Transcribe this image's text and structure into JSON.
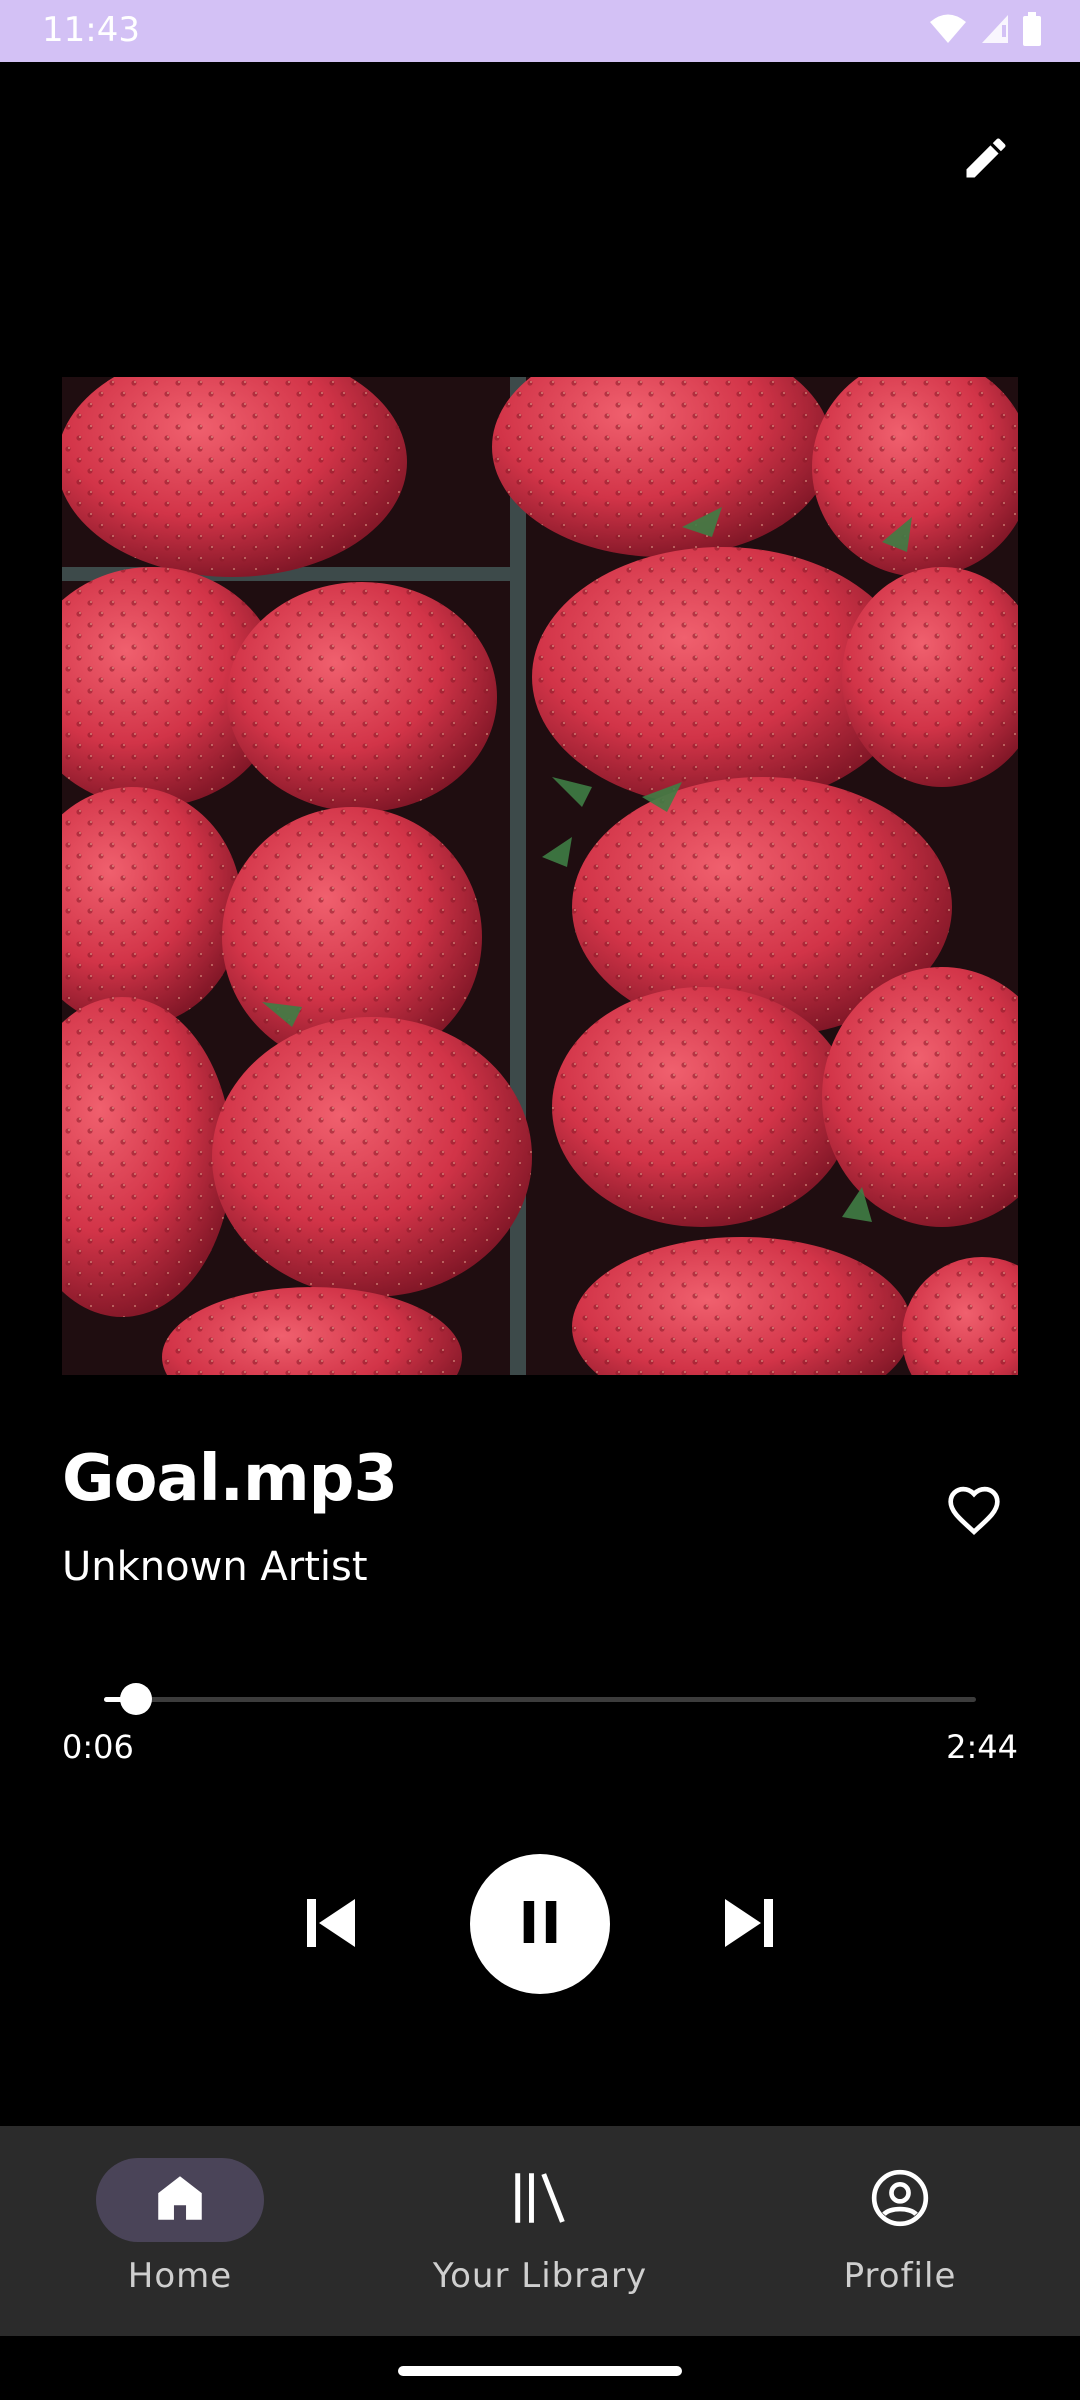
{
  "status_bar": {
    "time": "11:43",
    "background_color": "#d3c1f5",
    "icons": [
      "wifi-icon",
      "cell-signal-icon",
      "battery-icon"
    ]
  },
  "header": {
    "edit_icon": "pencil-icon"
  },
  "album_art": {
    "description_icon": "album-artwork-strawberries"
  },
  "track": {
    "title": "Goal.mp3",
    "artist": "Unknown Artist",
    "favorite_icon": "heart-outline-icon"
  },
  "progress": {
    "elapsed": "0:06",
    "total": "2:44",
    "fraction": 0.037
  },
  "controls": {
    "previous_icon": "skip-previous-icon",
    "play_pause_icon": "pause-icon",
    "next_icon": "skip-next-icon"
  },
  "bottom_nav": {
    "items": [
      {
        "label": "Home",
        "icon": "home-icon",
        "active": true
      },
      {
        "label": "Your Library",
        "icon": "library-icon",
        "active": false
      },
      {
        "label": "Profile",
        "icon": "account-circle-icon",
        "active": false
      }
    ]
  },
  "colors": {
    "background": "#000000",
    "nav_background": "#2b2b2b",
    "nav_active_pill": "#4a4458",
    "accent": "#ffffff"
  }
}
